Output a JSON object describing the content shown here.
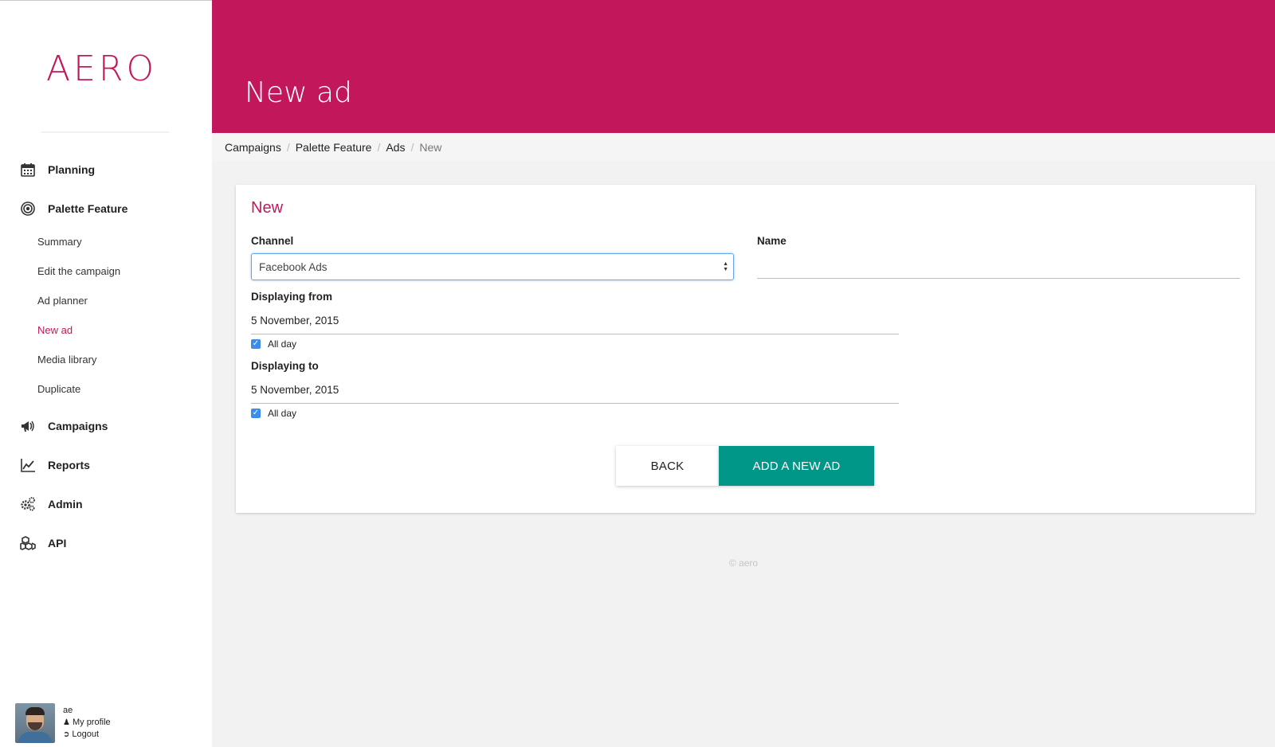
{
  "brand": {
    "logo_text": "AERO",
    "accent": "#c2185b"
  },
  "sidebar": {
    "main_items": [
      {
        "label": "Planning",
        "icon": "calendar-icon"
      },
      {
        "label": "Palette Feature",
        "icon": "target-icon"
      },
      {
        "label": "Campaigns",
        "icon": "megaphone-icon"
      },
      {
        "label": "Reports",
        "icon": "line-chart-icon"
      },
      {
        "label": "Admin",
        "icon": "gears-icon"
      },
      {
        "label": "API",
        "icon": "cubes-icon"
      }
    ],
    "sub_items": [
      {
        "label": "Summary"
      },
      {
        "label": "Edit the campaign"
      },
      {
        "label": "Ad planner"
      },
      {
        "label": "New ad",
        "active": true
      },
      {
        "label": "Media library"
      },
      {
        "label": "Duplicate"
      }
    ]
  },
  "user": {
    "name": "ae",
    "profile_label": "My profile",
    "logout_label": "Logout"
  },
  "header": {
    "title": "New ad"
  },
  "breadcrumb": {
    "items": [
      "Campaigns",
      "Palette Feature",
      "Ads",
      "New"
    ],
    "separator": "/"
  },
  "form": {
    "title": "New",
    "channel": {
      "label": "Channel",
      "value": "Facebook Ads"
    },
    "name": {
      "label": "Name",
      "value": ""
    },
    "displaying_from": {
      "label": "Displaying from",
      "value": "5 November, 2015",
      "all_day_label": "All day",
      "all_day_checked": true
    },
    "displaying_to": {
      "label": "Displaying to",
      "value": "5 November, 2015",
      "all_day_label": "All day",
      "all_day_checked": true
    },
    "back_label": "BACK",
    "submit_label": "ADD A NEW AD",
    "submit_color": "#009688"
  },
  "footer": {
    "text": "© aero"
  }
}
